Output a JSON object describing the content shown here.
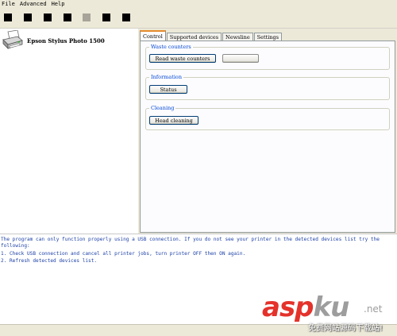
{
  "menu": {
    "items": [
      "File",
      "Advanced",
      "Help"
    ]
  },
  "toolbar": {
    "buttons": [
      {
        "icon": "black-square-icon"
      },
      {
        "icon": "black-square-icon"
      },
      {
        "icon": "black-square-icon"
      },
      {
        "icon": "black-square-icon"
      },
      {
        "icon": "gray-square-icon"
      },
      {
        "icon": "black-square-icon"
      },
      {
        "icon": "black-square-icon"
      }
    ]
  },
  "devices": {
    "items": [
      {
        "label": "Epson Stylus Photo 1500",
        "icon": "printer-icon"
      }
    ]
  },
  "tabs": [
    "Control",
    "Supported devices",
    "Newsline",
    "Settings"
  ],
  "active_tab": "Control",
  "control": {
    "waste": {
      "title": "Waste counters",
      "read_label": "Read waste counters",
      "reset_label": ""
    },
    "information": {
      "title": "Information",
      "status_label": "Status"
    },
    "cleaning": {
      "title": "Cleaning",
      "head_cleaning_label": "Head cleaning"
    }
  },
  "log": {
    "lines": [
      "The program can only function properly using a USB connection. If you do not see your printer in the detected devices list try the",
      "following:",
      "1. Check USB connection and cancel all printer jobs, turn printer OFF then ON again.",
      "2. Refresh detected devices list."
    ]
  },
  "watermark": {
    "brand_a": "asp",
    "brand_k": "ku",
    "tld": ".net",
    "sub": "免费网站源码下载站!"
  },
  "colors": {
    "log_text": "#1b3fa6",
    "group_title": "#0046d5",
    "active_tab_accent": "#e68b2c",
    "watermark_red": "#e4322b"
  }
}
